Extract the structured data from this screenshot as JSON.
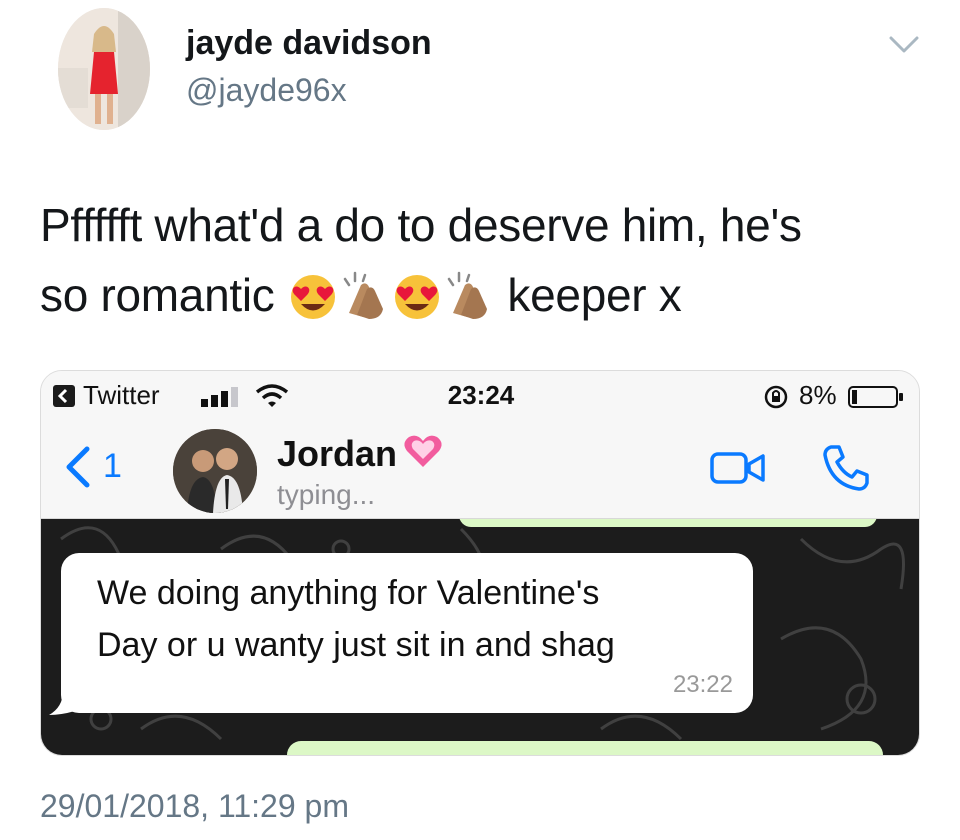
{
  "tweet": {
    "display_name": "jayde davidson",
    "handle": "@jayde96x",
    "text_line1": "Pffffft what'd a do to deserve him, he's",
    "text_line2_before": "so romantic",
    "text_line2_after": "keeper x",
    "emojis": [
      "heart-eyes-emoji",
      "clapping-hands-emoji",
      "heart-eyes-emoji",
      "clapping-hands-emoji"
    ],
    "timestamp": "29/01/2018, 11:29 pm"
  },
  "status_bar": {
    "back_app": "Twitter",
    "time": "23:24",
    "battery": "8%"
  },
  "chat": {
    "unread_count": "1",
    "contact_name": "Jordan",
    "status": "typing...",
    "message": {
      "line1": "We doing anything for Valentine's",
      "line2": "Day or u wanty just sit in and shag",
      "time": "23:22"
    }
  },
  "colors": {
    "ios_blue": "#0a7aff",
    "bubble_outgoing": "#dcf8c6",
    "chat_wallpaper": "#1c1c1c",
    "secondary_text": "#657786"
  }
}
